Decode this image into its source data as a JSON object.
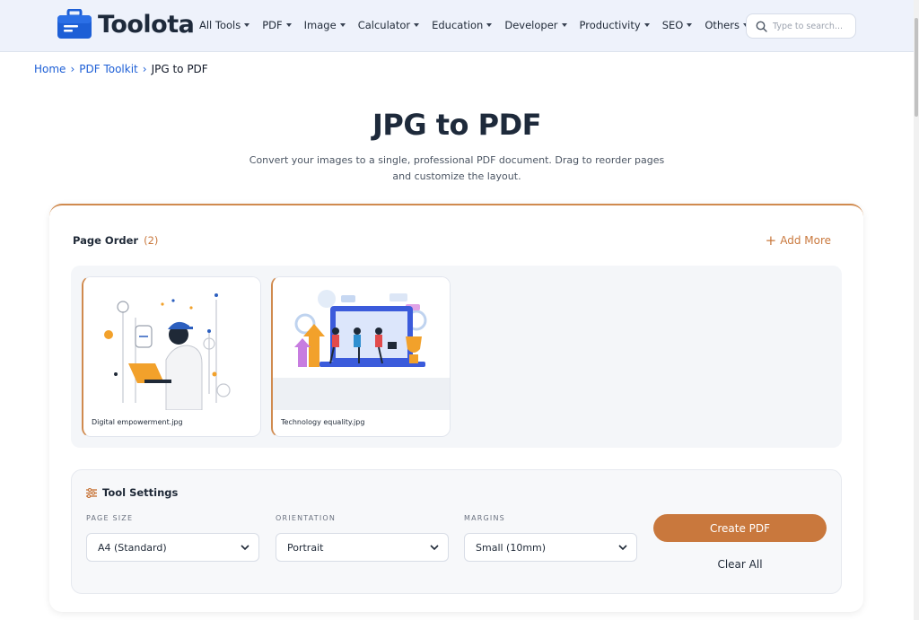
{
  "header": {
    "logo_text": "Toolota",
    "nav": [
      {
        "label": "All Tools"
      },
      {
        "label": "PDF"
      },
      {
        "label": "Image"
      },
      {
        "label": "Calculator"
      },
      {
        "label": "Education"
      },
      {
        "label": "Developer"
      },
      {
        "label": "Productivity"
      },
      {
        "label": "SEO"
      },
      {
        "label": "Others"
      }
    ],
    "search_placeholder": "Type to search..."
  },
  "breadcrumb": {
    "home": "Home",
    "toolkit": "PDF Toolkit",
    "current": "JPG to PDF"
  },
  "page": {
    "title": "JPG to PDF",
    "subtitle": "Convert your images to a single, professional PDF document. Drag to reorder pages and customize the layout."
  },
  "order": {
    "label": "Page Order",
    "count": "(2)",
    "add_more": "Add More",
    "pages": [
      {
        "filename": "Digital empowerment.jpg"
      },
      {
        "filename": "Technology equality.jpg"
      }
    ]
  },
  "settings": {
    "heading": "Tool Settings",
    "page_size": {
      "label": "PAGE SIZE",
      "value": "A4 (Standard)"
    },
    "orientation": {
      "label": "ORIENTATION",
      "value": "Portrait"
    },
    "margins": {
      "label": "MARGINS",
      "value": "Small (10mm)"
    },
    "create_button": "Create PDF",
    "clear_button": "Clear All"
  },
  "colors": {
    "accent": "#c9783d",
    "link": "#1d5fd6",
    "header_bg": "#eef2fb"
  }
}
